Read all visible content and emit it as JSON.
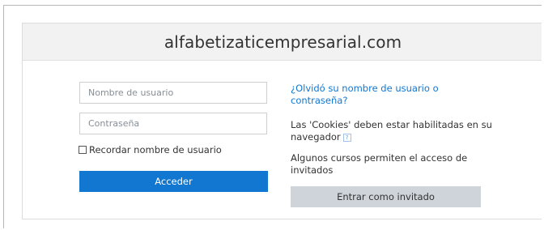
{
  "header": {
    "site_title": "alfabetizaticempresarial.com"
  },
  "login_form": {
    "username_placeholder": "Nombre de usuario",
    "password_placeholder": "Contraseña",
    "remember_label": "Recordar nombre de usuario",
    "remember_checked": false,
    "login_button": "Acceder"
  },
  "info": {
    "forgot_link": "¿Olvidó su nombre de usuario o contraseña?",
    "cookies_text": "Las 'Cookies' deben estar habilitadas en su navegador",
    "cookies_help_icon": "help-icon",
    "guest_text": "Algunos cursos permiten el acceso de invitados",
    "guest_button": "Entrar como invitado"
  },
  "colors": {
    "primary": "#1177d1",
    "header_bg": "#f2f2f2",
    "secondary_button": "#ced4da"
  }
}
